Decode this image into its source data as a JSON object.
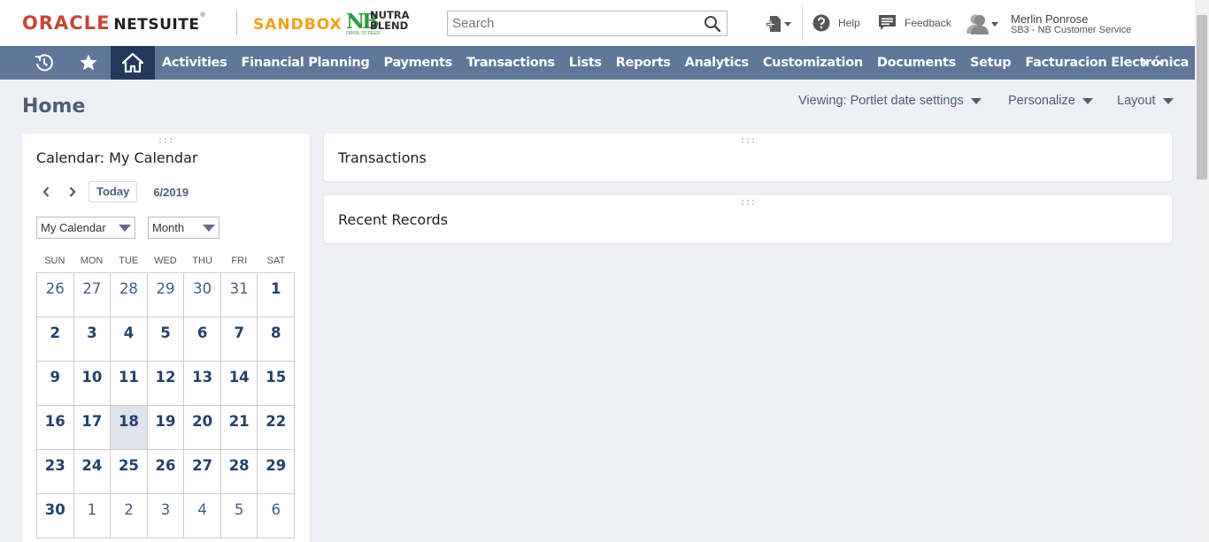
{
  "header": {
    "brand_oracle": "ORACLE",
    "brand_netsuite": "NETSUITE",
    "brand_reg": "®",
    "environment": "SANDBOX",
    "company_logo_line1": "NUTRA",
    "company_logo_line2": "BLEND",
    "company_logo_mark": "NB",
    "company_tagline": "DRIVE TO FEED",
    "search_placeholder": "Search",
    "help_label": "Help",
    "feedback_label": "Feedback",
    "user_name": "Merlin Ponrose",
    "user_role": "SB3 - NB Customer Service"
  },
  "nav": {
    "icons": [
      "recent-records-icon",
      "star-icon",
      "home-icon"
    ],
    "items": [
      "Activities",
      "Financial Planning",
      "Payments",
      "Transactions",
      "Lists",
      "Reports",
      "Analytics",
      "Customization",
      "Documents",
      "Setup",
      "Facturacion Electrónica"
    ],
    "more_icon": "more-icon"
  },
  "page": {
    "title": "Home",
    "viewing_label": "Viewing: Portlet date settings",
    "personalize_label": "Personalize",
    "layout_label": "Layout"
  },
  "calendar": {
    "title": "Calendar: My Calendar",
    "today_label": "Today",
    "month_label": "6/2019",
    "calendar_select": "My Calendar",
    "view_select": "Month",
    "weekdays": [
      "SUN",
      "MON",
      "TUE",
      "WED",
      "THU",
      "FRI",
      "SAT"
    ],
    "weeks": [
      [
        "26",
        "27",
        "28",
        "29",
        "30",
        "31",
        "1"
      ],
      [
        "2",
        "3",
        "4",
        "5",
        "6",
        "7",
        "8"
      ],
      [
        "9",
        "10",
        "11",
        "12",
        "13",
        "14",
        "15"
      ],
      [
        "16",
        "17",
        "18",
        "19",
        "20",
        "21",
        "22"
      ],
      [
        "23",
        "24",
        "25",
        "26",
        "27",
        "28",
        "29"
      ],
      [
        "30",
        "1",
        "2",
        "3",
        "4",
        "5",
        "6"
      ]
    ],
    "today_day": "18"
  },
  "portlets": {
    "transactions_title": "Transactions",
    "recent_records_title": "Recent Records"
  },
  "colors": {
    "navbar": "#607799",
    "navbar_active": "#24385b",
    "oracle_red": "#c74634",
    "sandbox_orange": "#f0a11c",
    "nutra_green": "#2f9a3f",
    "heading_blue": "#4d5f79",
    "background": "#eff0f5"
  }
}
